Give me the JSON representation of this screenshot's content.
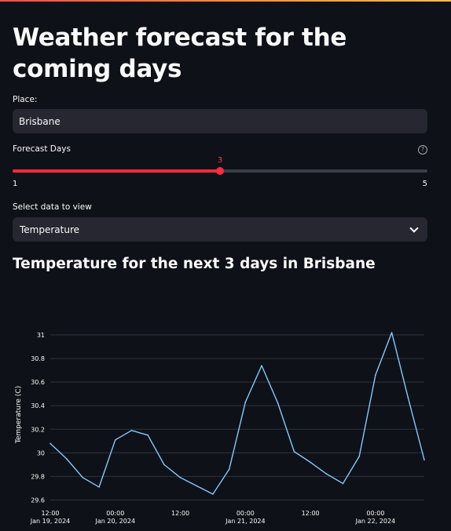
{
  "app": {
    "title": "Weather forecast for the coming days"
  },
  "place": {
    "label": "Place:",
    "value": "Brisbane"
  },
  "forecast_days": {
    "label": "Forecast Days",
    "value": 3,
    "min": 1,
    "max": 5,
    "value_text": "3",
    "min_text": "1",
    "max_text": "5",
    "help_icon": "question-circle-icon"
  },
  "data_select": {
    "label": "Select data to view",
    "selected": "Temperature",
    "icon": "chevron-down-icon"
  },
  "chart_section": {
    "heading": "Temperature for the next 3 days in Brisbane"
  },
  "colors": {
    "accent": "#ff2b3f",
    "line": "#83c9ff",
    "background": "#0e1117",
    "input_bg": "#262730"
  },
  "chart_data": {
    "type": "line",
    "title": "",
    "xlabel": "",
    "ylabel": "Temperature (C)",
    "ylim": [
      29.55,
      31.1
    ],
    "xlim": [
      0,
      69
    ],
    "grid": true,
    "x_tick_labels": [
      {
        "x": 0,
        "line1": "12:00",
        "line2": "Jan 19, 2024"
      },
      {
        "x": 12,
        "line1": "00:00",
        "line2": "Jan 20, 2024"
      },
      {
        "x": 24,
        "line1": "12:00",
        "line2": ""
      },
      {
        "x": 36,
        "line1": "00:00",
        "line2": "Jan 21, 2024"
      },
      {
        "x": 48,
        "line1": "12:00",
        "line2": ""
      },
      {
        "x": 60,
        "line1": "00:00",
        "line2": "Jan 22, 2024"
      }
    ],
    "y_ticks": [
      29.6,
      29.8,
      30,
      30.2,
      30.4,
      30.6,
      30.8,
      31
    ],
    "y_tick_labels": [
      "29.6",
      "29.8",
      "30",
      "30.2",
      "30.4",
      "30.6",
      "30.8",
      "31"
    ],
    "series": [
      {
        "x": [
          0,
          3,
          6,
          9,
          12,
          15,
          18,
          21,
          24,
          27,
          30,
          33,
          36,
          39,
          42,
          45,
          48,
          51,
          54,
          57,
          60,
          63,
          66,
          69
        ],
        "y": [
          30.08,
          29.95,
          29.79,
          29.71,
          30.11,
          30.19,
          30.15,
          29.9,
          29.79,
          29.72,
          29.65,
          29.86,
          30.43,
          30.74,
          30.42,
          30.01,
          29.92,
          29.82,
          29.74,
          29.97,
          30.66,
          31.02,
          30.47,
          29.94
        ]
      }
    ]
  }
}
